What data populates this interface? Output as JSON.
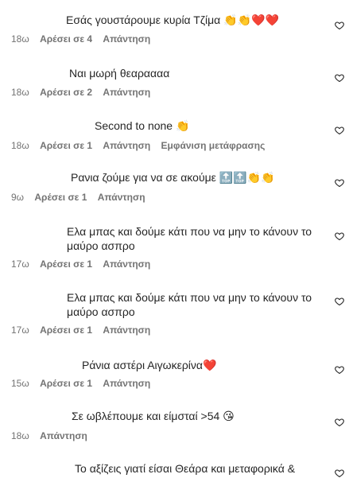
{
  "comments": [
    {
      "text": "Εσάς γουστάρουμε κυρία Τζίμα 👏👏❤️❤️",
      "time": "18ω",
      "likes": "Αρέσει σε 4",
      "reply": "Απάντηση",
      "translate": ""
    },
    {
      "text": "Ναι μωρή θεαραααα",
      "time": "18ω",
      "likes": "Αρέσει σε 2",
      "reply": "Απάντηση",
      "translate": ""
    },
    {
      "text": "Second to none 👏",
      "time": "18ω",
      "likes": "Αρέσει σε 1",
      "reply": "Απάντηση",
      "translate": "Εμφάνιση μετάφρασης"
    },
    {
      "text": "Ρανια ζούμε για να σε ακούμε 🔝🔝👏👏",
      "time": "9ω",
      "likes": "Αρέσει σε 1",
      "reply": "Απάντηση",
      "translate": ""
    },
    {
      "text": "Ελα μπας και δούμε κάτι που να μην το κάνουν το μαύρο ασπρο",
      "time": "17ω",
      "likes": "Αρέσει σε 1",
      "reply": "Απάντηση",
      "translate": ""
    },
    {
      "text": "Ελα μπας και δούμε κάτι που να μην το κάνουν το μαύρο ασπρο",
      "time": "17ω",
      "likes": "Αρέσει σε 1",
      "reply": "Απάντηση",
      "translate": ""
    },
    {
      "text": "Ράνια αστέρι Αιγωκερίνα❤️",
      "time": "15ω",
      "likes": "Αρέσει σε 1",
      "reply": "Απάντηση",
      "translate": ""
    },
    {
      "text": "Σε ωβλέπουμε και είμσταί >54 😘",
      "time": "18ω",
      "likes": "",
      "reply": "Απάντηση",
      "translate": ""
    },
    {
      "text": "Το αξίζεις γιατί είσαι Θεάρα και μεταφορικά &",
      "time": "",
      "likes": "",
      "reply": "",
      "translate": ""
    }
  ],
  "colors": {
    "text": "#262626",
    "meta": "#737373",
    "heart_stroke": "#262626"
  },
  "icons": {
    "like": "heart-outline-icon"
  }
}
